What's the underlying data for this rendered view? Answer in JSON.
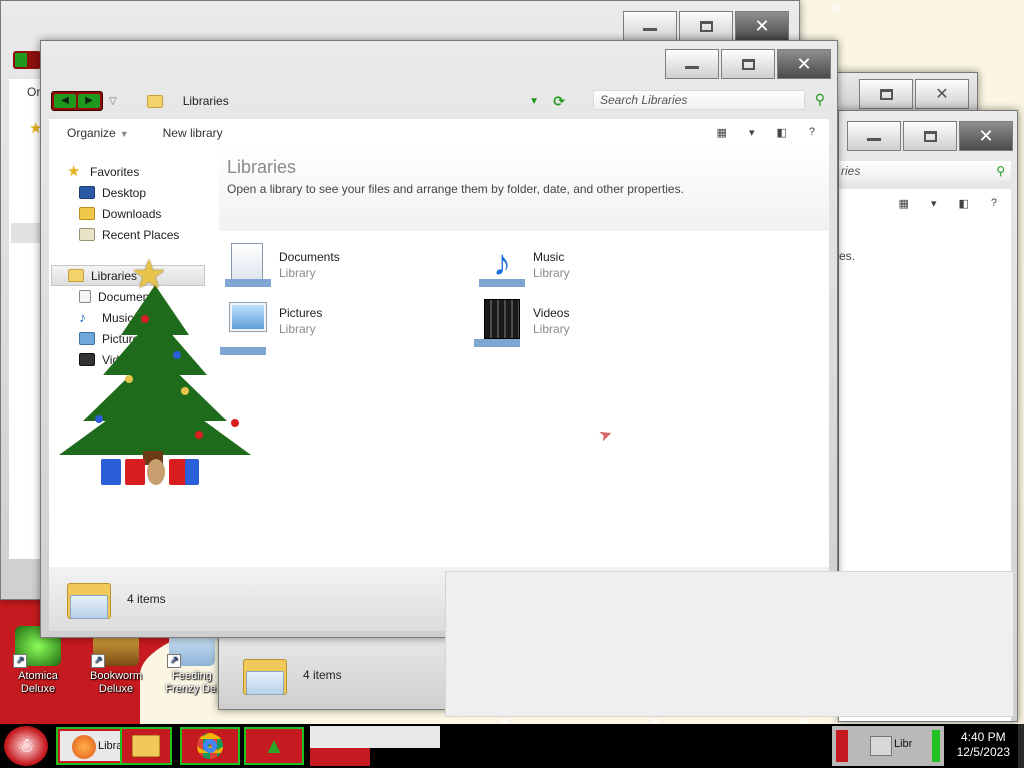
{
  "main_window": {
    "address": "Libraries",
    "search_placeholder": "Search Libraries",
    "toolbar": {
      "organize": "Organize",
      "new_library": "New library",
      "help": "?"
    },
    "nav": {
      "favorites": "Favorites",
      "favorites_items": [
        "Desktop",
        "Downloads",
        "Recent Places"
      ],
      "libraries": "Libraries",
      "libraries_items": [
        "Documents",
        "Music",
        "Pictures",
        "Videos"
      ]
    },
    "content": {
      "title": "Libraries",
      "subtitle": "Open a library to see your files and arrange them by folder, date, and other properties.",
      "items": [
        {
          "name": "Documents",
          "type": "Library",
          "icon": "documents-library-icon"
        },
        {
          "name": "Music",
          "type": "Library",
          "icon": "music-library-icon"
        },
        {
          "name": "Pictures",
          "type": "Library",
          "icon": "pictures-library-icon"
        },
        {
          "name": "Videos",
          "type": "Library",
          "icon": "videos-library-icon"
        }
      ]
    },
    "status": "4 items"
  },
  "back_windows": {
    "left_org": "Or",
    "right_address_fragment": "ries",
    "right_content_fragment": "es.",
    "bottom_status": "4 items"
  },
  "desktop_icons": [
    {
      "label": "Atomica\nDeluxe",
      "icon": "atomica-deluxe-icon"
    },
    {
      "label": "Bookworm\nDeluxe",
      "icon": "bookworm-deluxe-icon"
    },
    {
      "label": "Feeding\nFrenzy Del",
      "icon": "feeding-frenzy-icon"
    }
  ],
  "taskbar": {
    "items": [
      {
        "label": "Libra",
        "icon": "explorer-icon"
      },
      {
        "label": "",
        "icon": "firefox-icon"
      },
      {
        "label": "",
        "icon": "explorer-icon"
      },
      {
        "label": "",
        "icon": "chrome-icon"
      },
      {
        "label": "",
        "icon": "christmas-tree-icon"
      }
    ],
    "tray_label": "Libr",
    "time": "4:40 PM",
    "date": "12/5/2023"
  },
  "colors": {
    "taskbar": "#000000",
    "taskbar_border": "#1fc01f",
    "wallpaper_red": "#c51a1f",
    "accent_green": "#1f9a1f"
  }
}
